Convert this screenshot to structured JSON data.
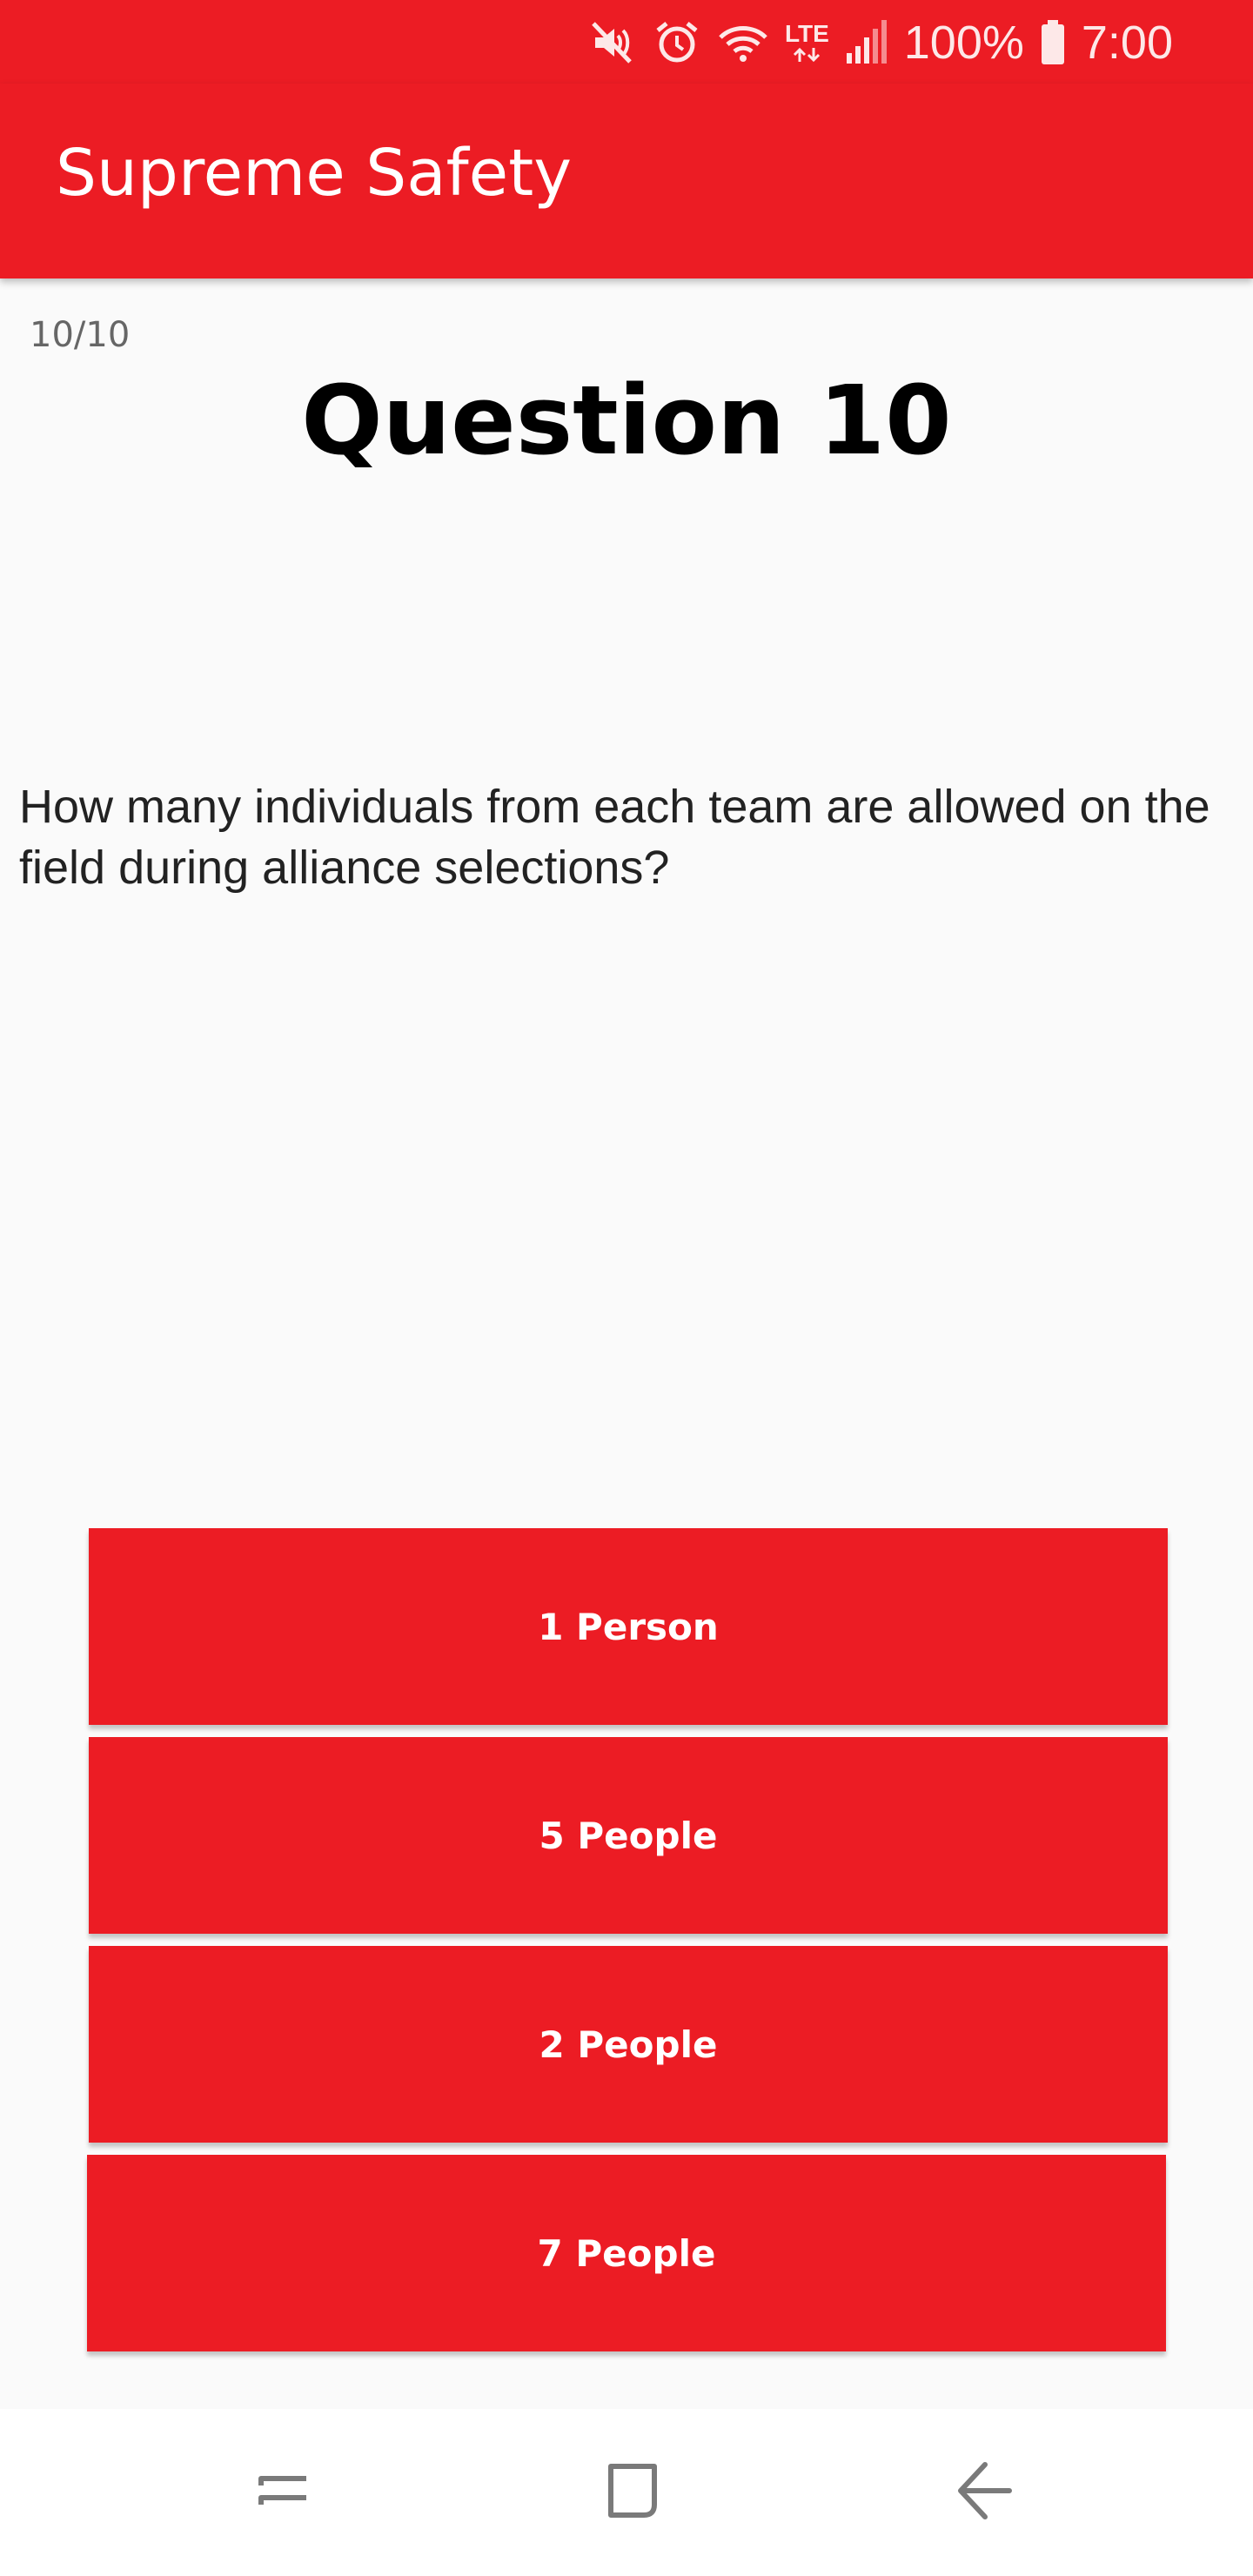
{
  "status_bar": {
    "battery": "100%",
    "time": "7:00",
    "network": "LTE",
    "icons": [
      "mute-icon",
      "alarm-icon",
      "wifi-icon",
      "lte-icon",
      "signal-icon",
      "battery-icon"
    ]
  },
  "app_bar": {
    "title": "Supreme Safety"
  },
  "quiz": {
    "progress": "10/10",
    "question_title": "Question 10",
    "question_text": "How many individuals from each team are allowed on the field during alliance selections?",
    "answers": [
      {
        "label": "1 Person"
      },
      {
        "label": "5 People"
      },
      {
        "label": "2 People"
      },
      {
        "label": "7 People"
      }
    ]
  },
  "nav_bar": {
    "buttons": [
      "recent-apps-icon",
      "home-icon",
      "back-icon"
    ]
  },
  "colors": {
    "accent": "#ec1c24",
    "background": "#fafafa"
  }
}
